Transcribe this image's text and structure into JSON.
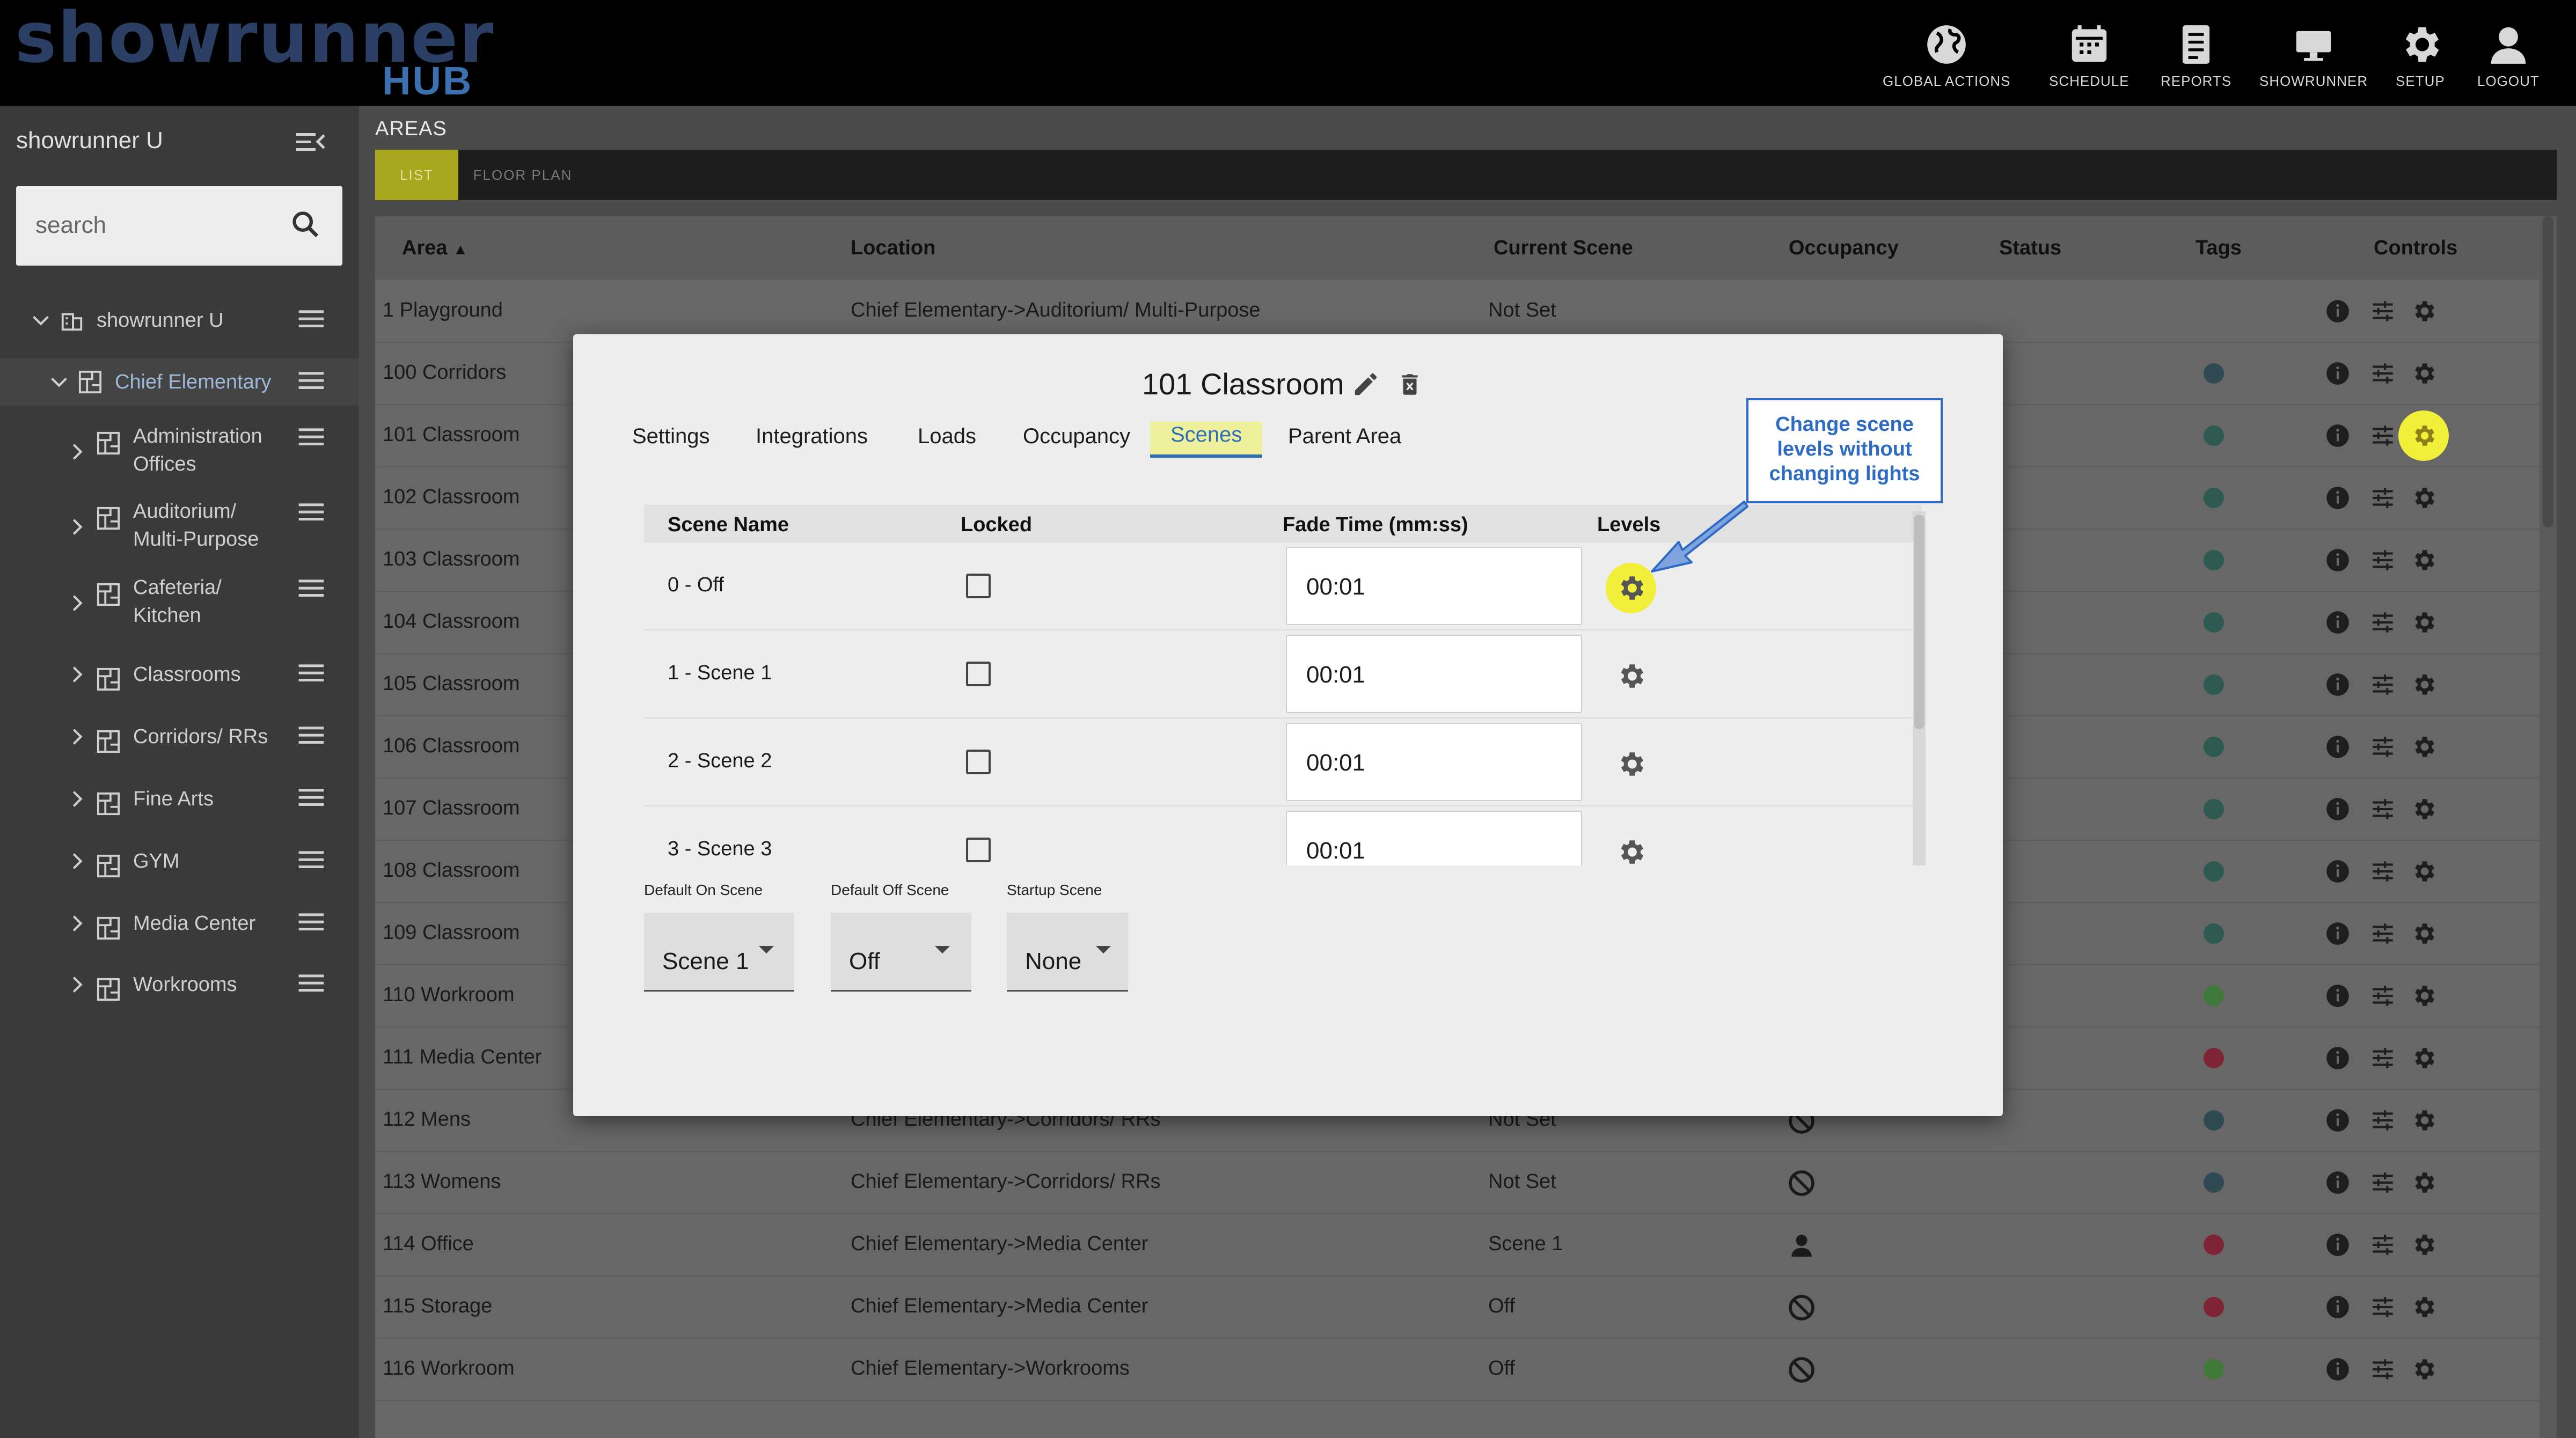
{
  "header": {
    "logo_text": "showrunner",
    "logo_sub": "HUB",
    "nav": [
      {
        "label": "GLOBAL ACTIONS",
        "icon": "globe-icon"
      },
      {
        "label": "SCHEDULE",
        "icon": "calendar-icon"
      },
      {
        "label": "REPORTS",
        "icon": "report-icon"
      },
      {
        "label": "SHOWRUNNER",
        "icon": "monitor-icon"
      },
      {
        "label": "SETUP",
        "icon": "gear-icon"
      },
      {
        "label": "LOGOUT",
        "icon": "user-icon"
      }
    ]
  },
  "sidebar": {
    "title": "showrunner U",
    "search_placeholder": "search",
    "tree": [
      {
        "label": "showrunner U",
        "level": 0,
        "expanded": true
      },
      {
        "label": "Chief Elementary",
        "level": 1,
        "expanded": true
      },
      {
        "label": "Administration\nOffices",
        "level": 2
      },
      {
        "label": "Auditorium/\nMulti-Purpose",
        "level": 2
      },
      {
        "label": "Cafeteria/\nKitchen",
        "level": 2
      },
      {
        "label": "Classrooms",
        "level": 2
      },
      {
        "label": "Corridors/ RRs",
        "level": 2
      },
      {
        "label": "Fine Arts",
        "level": 2
      },
      {
        "label": "GYM",
        "level": 2
      },
      {
        "label": "Media Center",
        "level": 2
      },
      {
        "label": "Workrooms",
        "level": 2
      }
    ]
  },
  "main": {
    "section_label": "AREAS",
    "tabs": [
      "LIST",
      "FLOOR PLAN"
    ],
    "active_tab": "LIST",
    "columns": [
      "Area",
      "Location",
      "Current Scene",
      "Occupancy",
      "Status",
      "Tags",
      "Controls"
    ],
    "sort_indicator": "▲",
    "rows": [
      {
        "area": "1 Playground",
        "location": "Chief Elementary->Auditorium/ Multi-Purpose",
        "scene": "Not Set",
        "occupancy": "",
        "tag": ""
      },
      {
        "area": "100 Corridors",
        "location": "",
        "scene": "",
        "occupancy": "",
        "tag": "#2f4a52"
      },
      {
        "area": "101 Classroom",
        "location": "",
        "scene": "",
        "occupancy": "",
        "tag": "#2e5a52"
      },
      {
        "area": "102 Classroom",
        "location": "",
        "scene": "",
        "occupancy": "",
        "tag": "#2e5a52"
      },
      {
        "area": "103 Classroom",
        "location": "",
        "scene": "",
        "occupancy": "",
        "tag": "#2e5a52"
      },
      {
        "area": "104 Classroom",
        "location": "",
        "scene": "",
        "occupancy": "",
        "tag": "#2e5a52"
      },
      {
        "area": "105 Classroom",
        "location": "",
        "scene": "",
        "occupancy": "",
        "tag": "#2e5a52"
      },
      {
        "area": "106 Classroom",
        "location": "",
        "scene": "",
        "occupancy": "",
        "tag": "#2e5a52"
      },
      {
        "area": "107 Classroom",
        "location": "",
        "scene": "",
        "occupancy": "",
        "tag": "#2e5a52"
      },
      {
        "area": "108 Classroom",
        "location": "",
        "scene": "",
        "occupancy": "",
        "tag": "#2e5a52"
      },
      {
        "area": "109 Classroom",
        "location": "",
        "scene": "",
        "occupancy": "",
        "tag": "#2e5a52"
      },
      {
        "area": "110 Workroom",
        "location": "",
        "scene": "",
        "occupancy": "",
        "tag": "#3f7a3a"
      },
      {
        "area": "111 Media Center",
        "location": "",
        "scene": "",
        "occupancy": "",
        "tag": "#7e2434"
      },
      {
        "area": "112 Mens",
        "location": "Chief Elementary->Corridors/ RRs",
        "scene": "Not Set",
        "occupancy": "none",
        "tag": "#2f4a52"
      },
      {
        "area": "113 Womens",
        "location": "Chief Elementary->Corridors/ RRs",
        "scene": "Not Set",
        "occupancy": "none",
        "tag": "#2f4a52"
      },
      {
        "area": "114 Office",
        "location": "Chief Elementary->Media Center",
        "scene": "Scene 1",
        "occupancy": "person",
        "tag": "#7e2434"
      },
      {
        "area": "115 Storage",
        "location": "Chief Elementary->Media Center",
        "scene": "Off",
        "occupancy": "none",
        "tag": "#7e2434"
      },
      {
        "area": "116 Workroom",
        "location": "Chief Elementary->Workrooms",
        "scene": "Off",
        "occupancy": "none",
        "tag": "#3f7a3a"
      }
    ]
  },
  "modal": {
    "title": "101 Classroom",
    "tabs": [
      "Settings",
      "Integrations",
      "Loads",
      "Occupancy",
      "Scenes",
      "Parent Area"
    ],
    "active_tab": "Scenes",
    "scene_columns": [
      "Scene Name",
      "Locked",
      "Fade Time (mm:ss)",
      "Levels"
    ],
    "scenes": [
      {
        "name": "0 - Off",
        "fade": "00:01",
        "locked": false
      },
      {
        "name": "1 - Scene 1",
        "fade": "00:01",
        "locked": false
      },
      {
        "name": "2 - Scene 2",
        "fade": "00:01",
        "locked": false
      },
      {
        "name": "3 - Scene 3",
        "fade": "00:01",
        "locked": false
      }
    ],
    "selects": [
      {
        "label": "Default On Scene",
        "value": "Scene 1"
      },
      {
        "label": "Default Off Scene",
        "value": "Off"
      },
      {
        "label": "Startup Scene",
        "value": "None"
      }
    ]
  },
  "callout": {
    "text": "Change scene levels without changing lights",
    "color": "#2e6bc4",
    "highlight_color": "#f2ef3a"
  }
}
